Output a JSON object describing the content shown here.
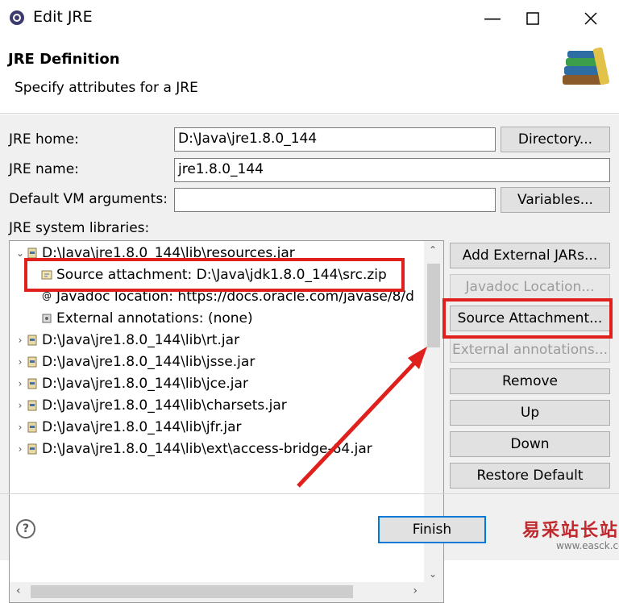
{
  "window": {
    "title": "Edit JRE"
  },
  "header": {
    "title": "JRE Definition",
    "subtitle": "Specify attributes for a JRE"
  },
  "form": {
    "jre_home_label": "JRE home:",
    "jre_home_value": "D:\\Java\\jre1.8.0_144",
    "directory_button": "Directory...",
    "jre_name_label": "JRE name:",
    "jre_name_value": "jre1.8.0_144",
    "vm_args_label": "Default VM arguments:",
    "vm_args_value": "",
    "variables_button": "Variables...",
    "libraries_label": "JRE system libraries:"
  },
  "tree": {
    "items": [
      {
        "label": "D:\\Java\\jre1.8.0_144\\lib\\resources.jar",
        "expanded": true
      },
      {
        "label": "Source attachment: D:\\Java\\jdk1.8.0_144\\src.zip",
        "child": true
      },
      {
        "label": "Javadoc location: https://docs.oracle.com/javase/8/d",
        "child": true
      },
      {
        "label": "External annotations: (none)",
        "child": true
      },
      {
        "label": "D:\\Java\\jre1.8.0_144\\lib\\rt.jar"
      },
      {
        "label": "D:\\Java\\jre1.8.0_144\\lib\\jsse.jar"
      },
      {
        "label": "D:\\Java\\jre1.8.0_144\\lib\\jce.jar"
      },
      {
        "label": "D:\\Java\\jre1.8.0_144\\lib\\charsets.jar"
      },
      {
        "label": "D:\\Java\\jre1.8.0_144\\lib\\jfr.jar"
      },
      {
        "label": "D:\\Java\\jre1.8.0_144\\lib\\ext\\access-bridge-64.jar"
      }
    ]
  },
  "side_buttons": {
    "add_external_jars": "Add External JARs...",
    "javadoc_location": "Javadoc Location...",
    "source_attachment": "Source Attachment...",
    "external_annotations": "External annotations...",
    "remove": "Remove",
    "up": "Up",
    "down": "Down",
    "restore_default": "Restore Default"
  },
  "footer": {
    "finish": "Finish"
  },
  "watermark": {
    "text": "易采站长站",
    "url": "www.easck.com"
  },
  "colors": {
    "highlight": "#e0201c",
    "dialog_bg": "#f0f0f0",
    "button_bg": "#e1e1e1"
  }
}
